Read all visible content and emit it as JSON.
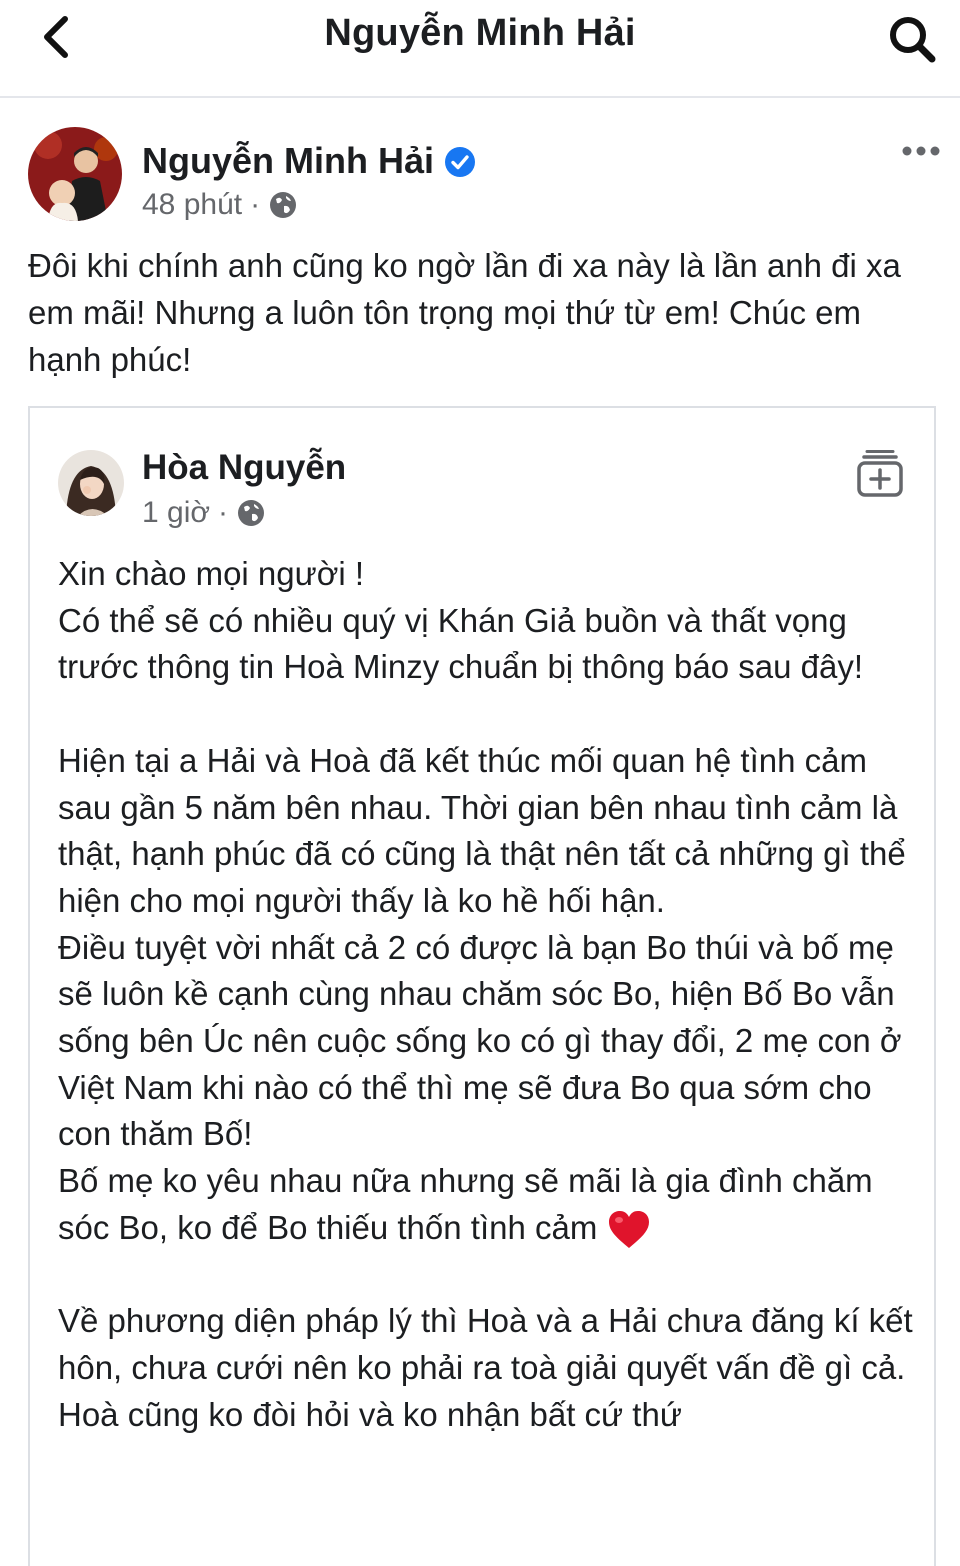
{
  "header": {
    "title": "Nguyễn Minh Hải",
    "back_icon": "chevron-left-icon",
    "search_icon": "search-icon"
  },
  "post": {
    "author": "Nguyễn Minh Hải",
    "verified": true,
    "time": "48 phút",
    "separator": "·",
    "audience_icon": "globe-icon",
    "more_icon": "more-dots-icon",
    "text": "Đôi khi chính anh cũng ko ngờ lần đi xa này là lần anh đi xa em mãi! Nhưng a luôn tôn trọng mọi thứ từ em! Chúc em hạnh phúc!"
  },
  "shared": {
    "author": "Hòa Nguyễn",
    "time": "1 giờ",
    "separator": "·",
    "save_icon": "save-collection-icon",
    "lines": {
      "l1": "Xin chào mọi người !",
      "l2": "Có thể sẽ có nhiều quý vị Khán Giả buồn và thất vọng trước thông tin Hoà Minzy chuẩn bị thông báo sau đây!",
      "l3": "Hiện tại a Hải và Hoà đã kết thúc mối quan hệ tình cảm sau gần 5 năm bên nhau. Thời gian bên nhau tình cảm là thật, hạnh phúc đã có cũng là thật nên tất cả những gì thể hiện cho mọi người thấy là ko hề hối hận.",
      "l4": "Điều tuyệt vời nhất cả 2 có được là bạn Bo thúi và bố mẹ sẽ luôn kề cạnh cùng nhau chăm sóc Bo, hiện Bố Bo vẫn sống bên Úc nên cuộc sống ko có gì thay đổi, 2 mẹ con ở Việt Nam khi nào có thể thì mẹ sẽ đưa Bo qua sớm cho con thăm Bố!",
      "l5": "Bố mẹ ko yêu nhau nữa nhưng sẽ mãi là gia đình chăm sóc Bo, ko để Bo thiếu thốn tình cảm",
      "l6": "Về phương diện pháp lý thì Hoà và a Hải chưa đăng kí kết hôn, chưa cưới nên ko phải ra toà giải quyết vấn đề gì cả. Hoà cũng ko đòi hỏi và ko nhận bất cứ thứ"
    },
    "emoji": "heart-icon"
  },
  "colors": {
    "verified_blue": "#1877f2",
    "meta_gray": "#65676b",
    "heart_red": "#e0142c"
  }
}
